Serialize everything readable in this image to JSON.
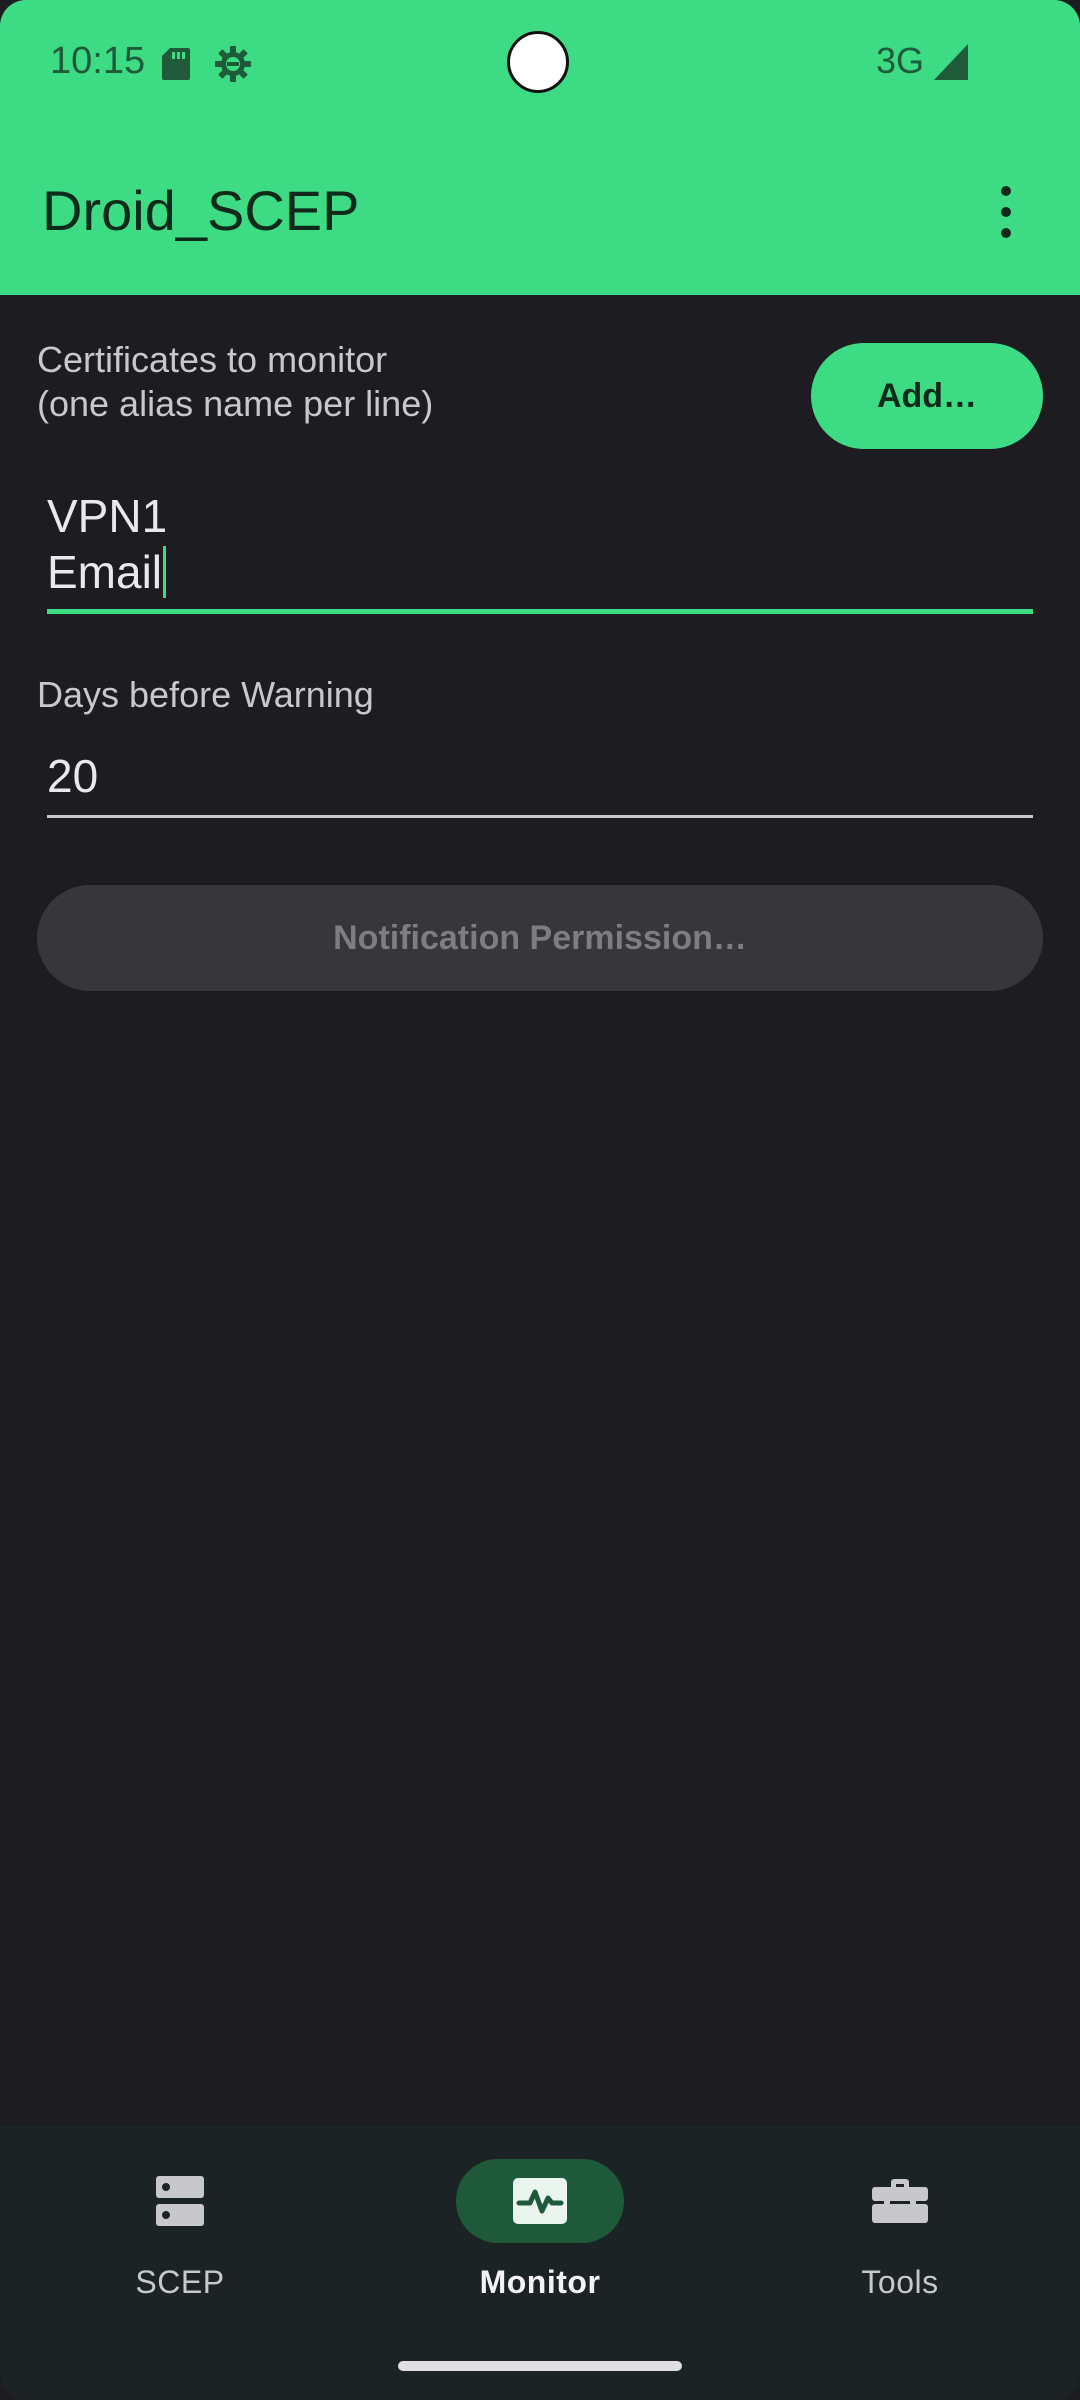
{
  "status_bar": {
    "time": "10:15",
    "network": "3G",
    "icons": [
      "sd-card-icon",
      "settings-gear-icon",
      "signal-icon"
    ]
  },
  "app_bar": {
    "title": "Droid_SCEP",
    "menu_icon": "more-vert-icon"
  },
  "monitor": {
    "cert_label_line1": "Certificates to monitor",
    "cert_label_line2": "(one alias name per line)",
    "add_button": "Add…",
    "aliases": [
      "VPN1",
      "Email"
    ],
    "days_label": "Days before Warning",
    "days_value": "20",
    "notification_button": "Notification Permission…"
  },
  "bottom_nav": {
    "items": [
      {
        "label": "SCEP",
        "icon": "server-icon",
        "active": false
      },
      {
        "label": "Monitor",
        "icon": "monitor-heartbeat-icon",
        "active": true
      },
      {
        "label": "Tools",
        "icon": "toolbox-icon",
        "active": false
      }
    ]
  },
  "colors": {
    "accent": "#3ddc84",
    "background": "#1c1c21",
    "nav_background": "#1c2324",
    "active_pill": "#1e5a39",
    "disabled_button": "#36363b"
  }
}
